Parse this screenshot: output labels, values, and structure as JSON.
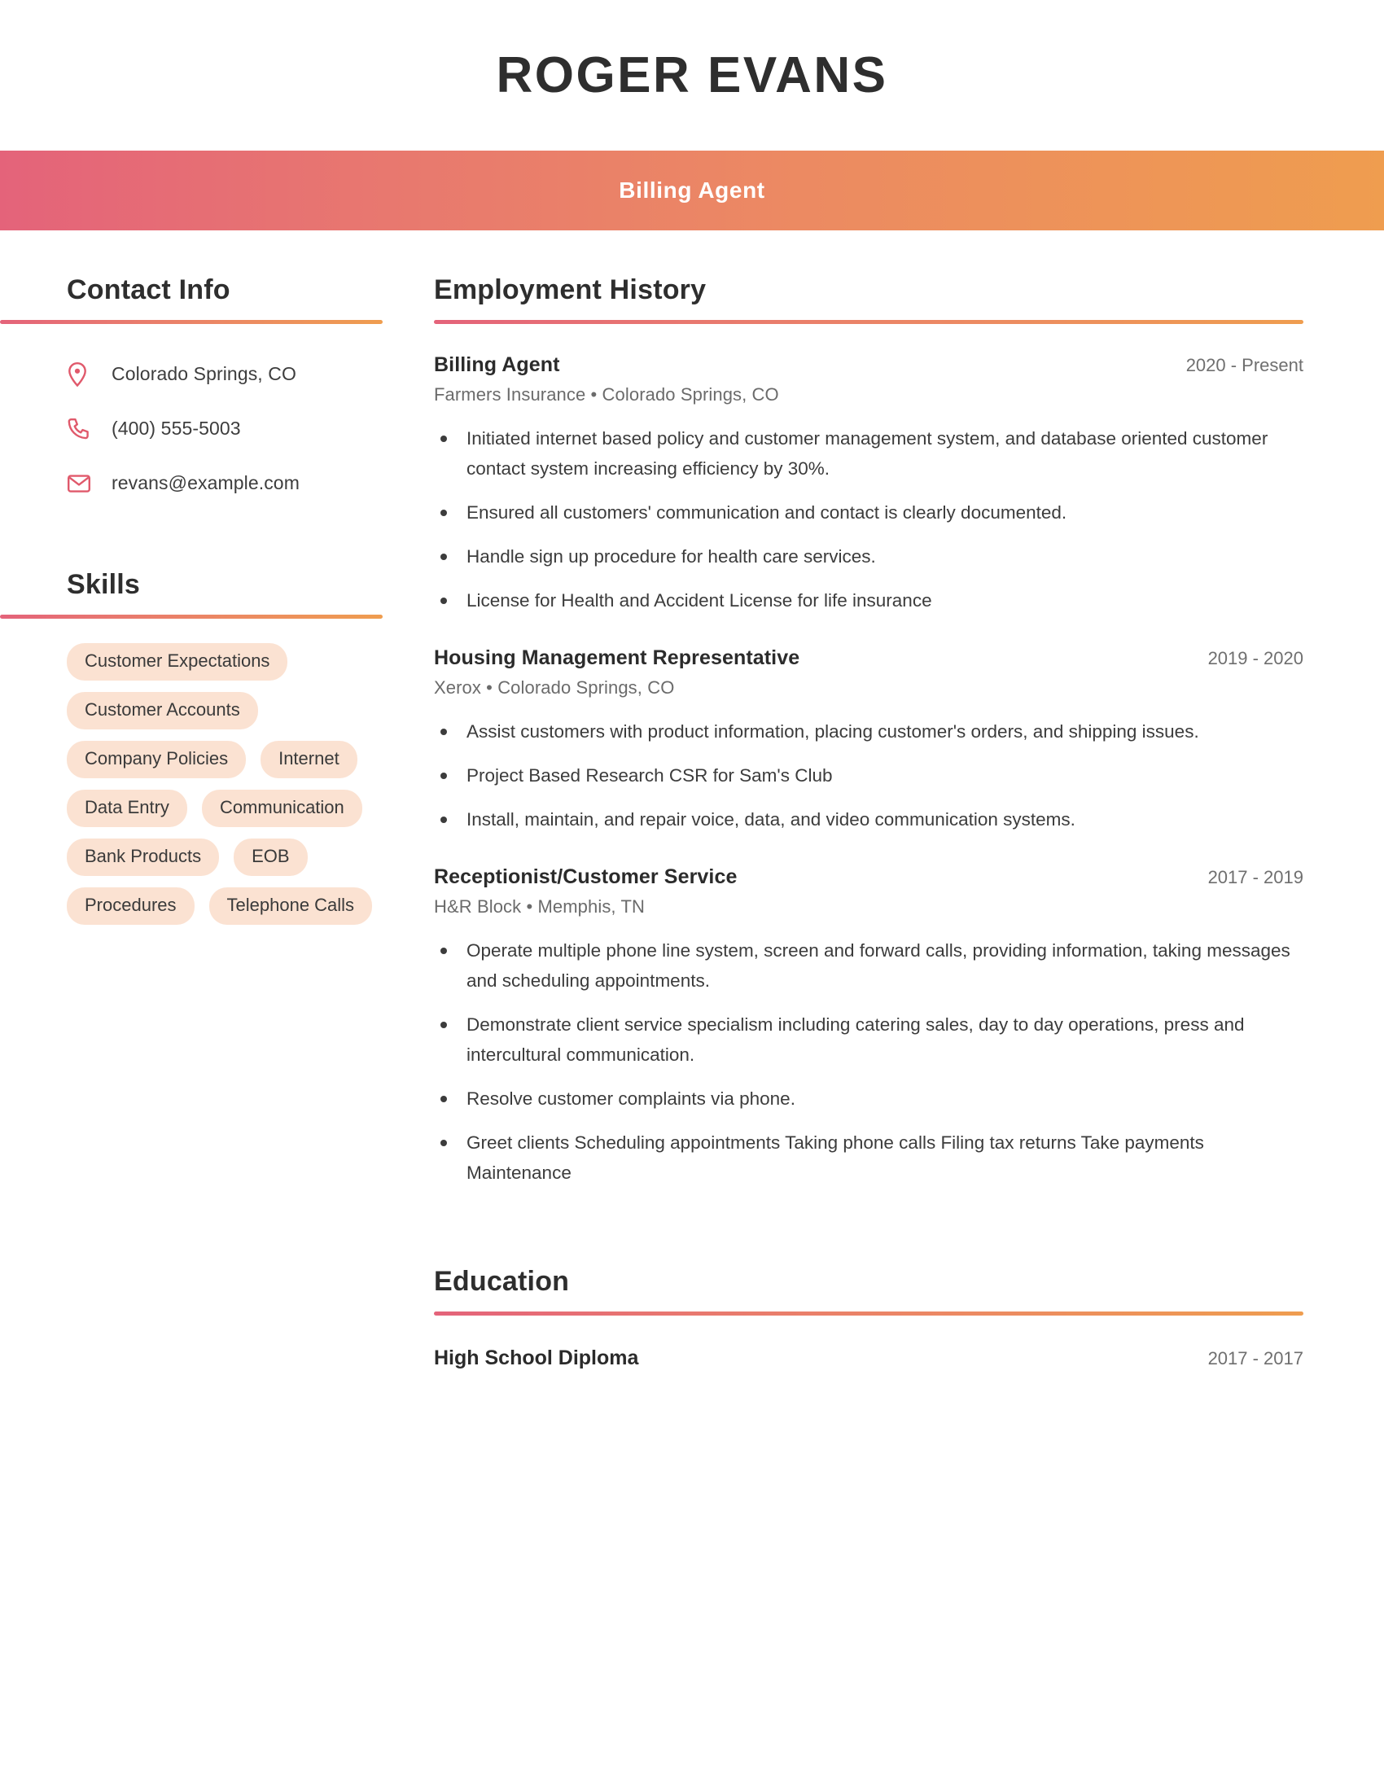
{
  "header": {
    "name": "ROGER EVANS",
    "job_title": "Billing Agent",
    "band_gradient_start": "#e4637a",
    "band_gradient_end": "#ef9d4f"
  },
  "theme": {
    "accent_pink": "#e4637a",
    "accent_orange": "#ef9d4f",
    "icon_color": "#e0596b",
    "pill_background": "#fbe2d2",
    "text_dark": "#2e2e2e",
    "text_muted": "#6b6b6b"
  },
  "sidebar": {
    "contact": {
      "heading": "Contact Info",
      "items": [
        {
          "icon": "location-pin-icon",
          "value": "Colorado Springs, CO"
        },
        {
          "icon": "phone-icon",
          "value": "(400) 555-5003"
        },
        {
          "icon": "envelope-icon",
          "value": "revans@example.com"
        }
      ]
    },
    "skills": {
      "heading": "Skills",
      "items": [
        "Customer Expectations",
        "Customer Accounts",
        "Company Policies",
        "Internet",
        "Data Entry",
        "Communication",
        "Bank Products",
        "EOB",
        "Procedures",
        "Telephone Calls"
      ]
    }
  },
  "main": {
    "employment": {
      "heading": "Employment History",
      "jobs": [
        {
          "title": "Billing Agent",
          "dates": "2020 - Present",
          "meta": "Farmers Insurance  •  Colorado Springs, CO",
          "bullets": [
            "Initiated internet based policy and customer management system, and database oriented customer contact system increasing efficiency by 30%.",
            "Ensured all customers' communication and contact is clearly documented.",
            "Handle sign up procedure for health care services.",
            "License for Health and Accident License for life insurance"
          ]
        },
        {
          "title": "Housing Management Representative",
          "dates": "2019 - 2020",
          "meta": "Xerox  •  Colorado Springs, CO",
          "bullets": [
            "Assist customers with product information, placing customer's orders, and shipping issues.",
            "Project Based Research CSR for Sam's Club",
            "Install, maintain, and repair voice, data, and video communication systems."
          ]
        },
        {
          "title": "Receptionist/Customer Service",
          "dates": "2017 - 2019",
          "meta": "H&R Block  •  Memphis, TN",
          "bullets": [
            "Operate multiple phone line system, screen and forward calls, providing information, taking messages and scheduling appointments.",
            "Demonstrate client service specialism including catering sales, day to day operations, press and intercultural communication.",
            "Resolve customer complaints via phone.",
            "Greet clients Scheduling appointments Taking phone calls Filing tax returns Take payments Maintenance"
          ]
        }
      ]
    },
    "education": {
      "heading": "Education",
      "entries": [
        {
          "degree": "High School Diploma",
          "dates": "2017 - 2017"
        }
      ]
    }
  }
}
